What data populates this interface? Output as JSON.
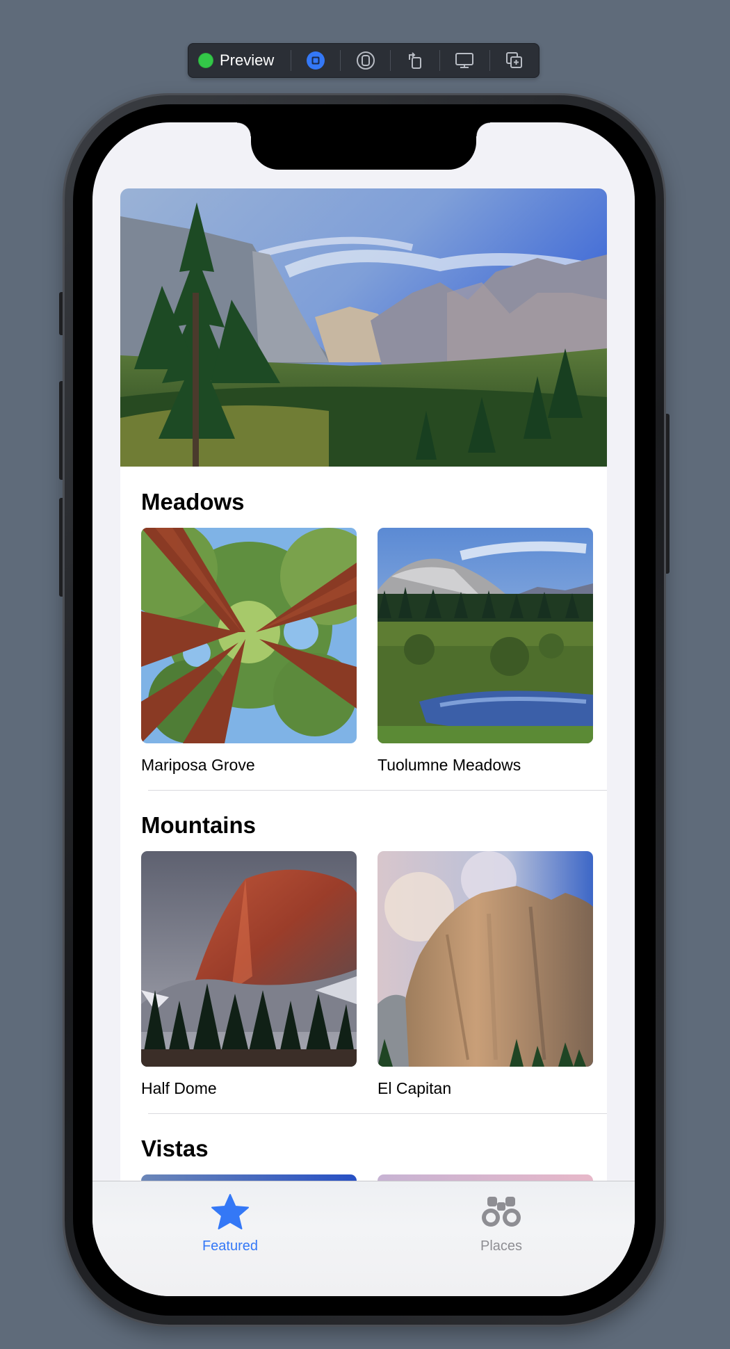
{
  "toolbar": {
    "preview_label": "Preview",
    "status_color": "#33c748",
    "buttons": [
      "live-preview-icon",
      "inspect-icon",
      "rotate-icon",
      "device-settings-icon",
      "duplicate-icon"
    ]
  },
  "sections": [
    {
      "title": "Meadows",
      "items": [
        {
          "label": "Mariposa Grove"
        },
        {
          "label": "Tuolumne Meadows"
        }
      ]
    },
    {
      "title": "Mountains",
      "items": [
        {
          "label": "Half Dome"
        },
        {
          "label": "El Capitan"
        }
      ]
    },
    {
      "title": "Vistas",
      "items": []
    }
  ],
  "tabbar": {
    "tabs": [
      {
        "label": "Featured",
        "icon": "star-icon",
        "selected": true
      },
      {
        "label": "Places",
        "icon": "binoculars-icon",
        "selected": false
      }
    ],
    "accent_color": "#3478f6"
  }
}
